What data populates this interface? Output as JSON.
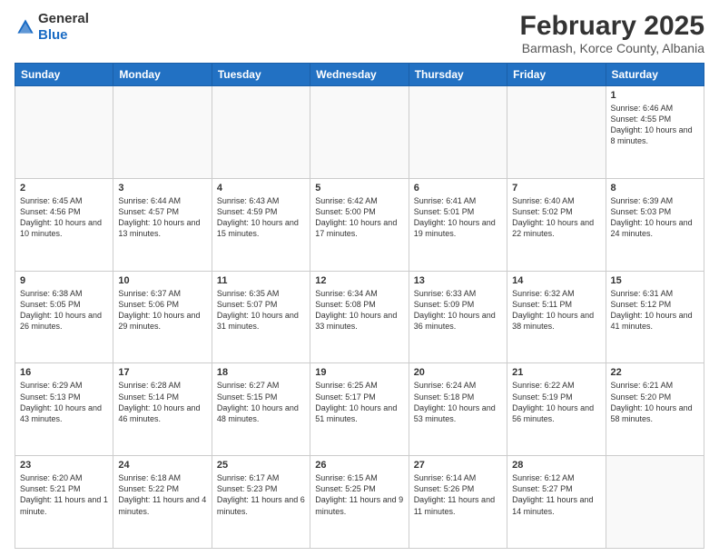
{
  "header": {
    "logo": {
      "general": "General",
      "blue": "Blue"
    },
    "title": "February 2025",
    "location": "Barmash, Korce County, Albania"
  },
  "weekdays": [
    "Sunday",
    "Monday",
    "Tuesday",
    "Wednesday",
    "Thursday",
    "Friday",
    "Saturday"
  ],
  "weeks": [
    [
      {
        "day": "",
        "info": ""
      },
      {
        "day": "",
        "info": ""
      },
      {
        "day": "",
        "info": ""
      },
      {
        "day": "",
        "info": ""
      },
      {
        "day": "",
        "info": ""
      },
      {
        "day": "",
        "info": ""
      },
      {
        "day": "1",
        "info": "Sunrise: 6:46 AM\nSunset: 4:55 PM\nDaylight: 10 hours and 8 minutes."
      }
    ],
    [
      {
        "day": "2",
        "info": "Sunrise: 6:45 AM\nSunset: 4:56 PM\nDaylight: 10 hours and 10 minutes."
      },
      {
        "day": "3",
        "info": "Sunrise: 6:44 AM\nSunset: 4:57 PM\nDaylight: 10 hours and 13 minutes."
      },
      {
        "day": "4",
        "info": "Sunrise: 6:43 AM\nSunset: 4:59 PM\nDaylight: 10 hours and 15 minutes."
      },
      {
        "day": "5",
        "info": "Sunrise: 6:42 AM\nSunset: 5:00 PM\nDaylight: 10 hours and 17 minutes."
      },
      {
        "day": "6",
        "info": "Sunrise: 6:41 AM\nSunset: 5:01 PM\nDaylight: 10 hours and 19 minutes."
      },
      {
        "day": "7",
        "info": "Sunrise: 6:40 AM\nSunset: 5:02 PM\nDaylight: 10 hours and 22 minutes."
      },
      {
        "day": "8",
        "info": "Sunrise: 6:39 AM\nSunset: 5:03 PM\nDaylight: 10 hours and 24 minutes."
      }
    ],
    [
      {
        "day": "9",
        "info": "Sunrise: 6:38 AM\nSunset: 5:05 PM\nDaylight: 10 hours and 26 minutes."
      },
      {
        "day": "10",
        "info": "Sunrise: 6:37 AM\nSunset: 5:06 PM\nDaylight: 10 hours and 29 minutes."
      },
      {
        "day": "11",
        "info": "Sunrise: 6:35 AM\nSunset: 5:07 PM\nDaylight: 10 hours and 31 minutes."
      },
      {
        "day": "12",
        "info": "Sunrise: 6:34 AM\nSunset: 5:08 PM\nDaylight: 10 hours and 33 minutes."
      },
      {
        "day": "13",
        "info": "Sunrise: 6:33 AM\nSunset: 5:09 PM\nDaylight: 10 hours and 36 minutes."
      },
      {
        "day": "14",
        "info": "Sunrise: 6:32 AM\nSunset: 5:11 PM\nDaylight: 10 hours and 38 minutes."
      },
      {
        "day": "15",
        "info": "Sunrise: 6:31 AM\nSunset: 5:12 PM\nDaylight: 10 hours and 41 minutes."
      }
    ],
    [
      {
        "day": "16",
        "info": "Sunrise: 6:29 AM\nSunset: 5:13 PM\nDaylight: 10 hours and 43 minutes."
      },
      {
        "day": "17",
        "info": "Sunrise: 6:28 AM\nSunset: 5:14 PM\nDaylight: 10 hours and 46 minutes."
      },
      {
        "day": "18",
        "info": "Sunrise: 6:27 AM\nSunset: 5:15 PM\nDaylight: 10 hours and 48 minutes."
      },
      {
        "day": "19",
        "info": "Sunrise: 6:25 AM\nSunset: 5:17 PM\nDaylight: 10 hours and 51 minutes."
      },
      {
        "day": "20",
        "info": "Sunrise: 6:24 AM\nSunset: 5:18 PM\nDaylight: 10 hours and 53 minutes."
      },
      {
        "day": "21",
        "info": "Sunrise: 6:22 AM\nSunset: 5:19 PM\nDaylight: 10 hours and 56 minutes."
      },
      {
        "day": "22",
        "info": "Sunrise: 6:21 AM\nSunset: 5:20 PM\nDaylight: 10 hours and 58 minutes."
      }
    ],
    [
      {
        "day": "23",
        "info": "Sunrise: 6:20 AM\nSunset: 5:21 PM\nDaylight: 11 hours and 1 minute."
      },
      {
        "day": "24",
        "info": "Sunrise: 6:18 AM\nSunset: 5:22 PM\nDaylight: 11 hours and 4 minutes."
      },
      {
        "day": "25",
        "info": "Sunrise: 6:17 AM\nSunset: 5:23 PM\nDaylight: 11 hours and 6 minutes."
      },
      {
        "day": "26",
        "info": "Sunrise: 6:15 AM\nSunset: 5:25 PM\nDaylight: 11 hours and 9 minutes."
      },
      {
        "day": "27",
        "info": "Sunrise: 6:14 AM\nSunset: 5:26 PM\nDaylight: 11 hours and 11 minutes."
      },
      {
        "day": "28",
        "info": "Sunrise: 6:12 AM\nSunset: 5:27 PM\nDaylight: 11 hours and 14 minutes."
      },
      {
        "day": "",
        "info": ""
      }
    ]
  ]
}
